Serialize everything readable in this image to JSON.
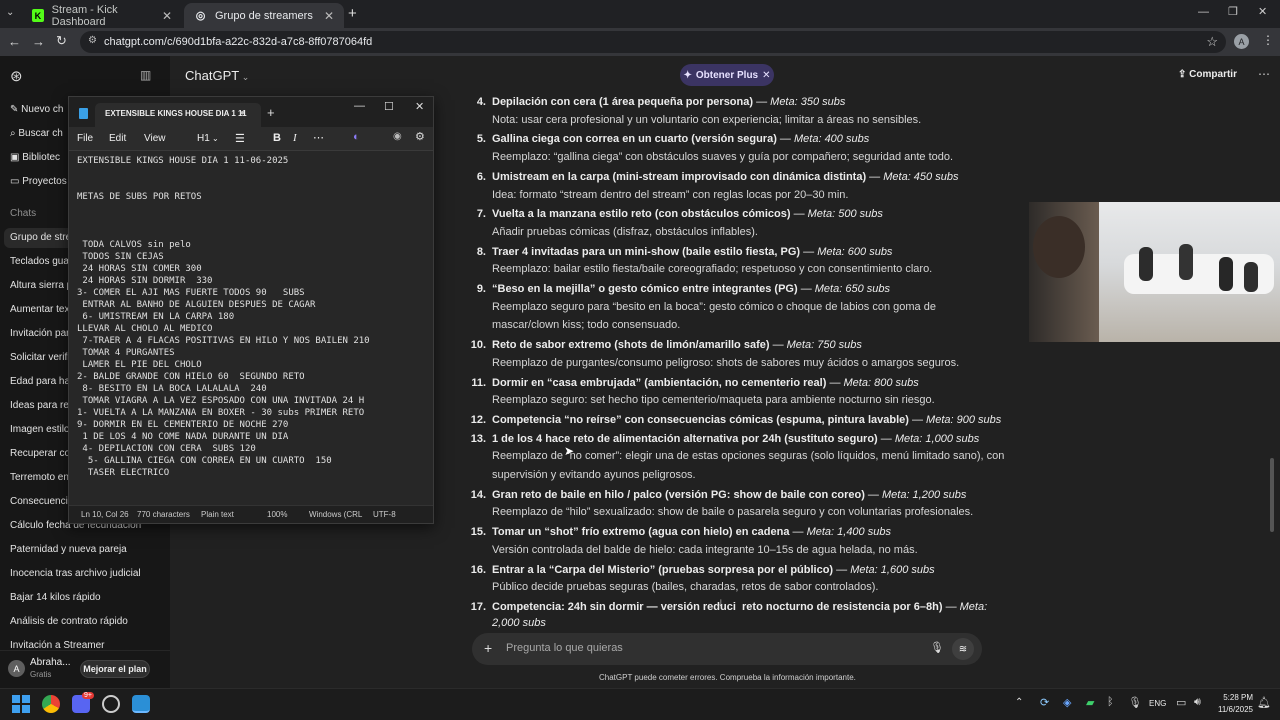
{
  "browser": {
    "tabs": [
      {
        "title": "Stream - Kick Dashboard",
        "active": false,
        "fav": "K"
      },
      {
        "title": "Grupo de streamers",
        "active": true,
        "fav": "◎"
      }
    ],
    "new_tab": "+",
    "url": "chatgpt.com/c/690d1bfa-a22c-832d-a7c8-8ff0787064fd",
    "profile_initial": "A"
  },
  "sidebar": {
    "top_items": [
      "Nuevo ch",
      "Buscar ch",
      "Bibliotec",
      "Proyectos"
    ],
    "chats_heading": "Chats",
    "chats": [
      "Grupo de stre",
      "Teclados guar",
      "Altura sierra p",
      "Aumentar tex",
      "Invitación par",
      "Solicitar verifi",
      "Edad para hal",
      "Ideas para ret",
      "Imagen estilo",
      "Recuperar con",
      "Terremoto en",
      "Consecuencia",
      "Cálculo fecha de fecundación",
      "Paternidad y nueva pareja",
      "Inocencia tras archivo judicial",
      "Bajar 14 kilos rápido",
      "Análisis de contrato rápido",
      "Invitación a Streamer"
    ],
    "user_initial": "A",
    "user_name": "Abraha...",
    "user_plan": "Gratis",
    "upgrade_button": "Mejorar el plan"
  },
  "header": {
    "model": "ChatGPT",
    "plus_button": "Obtener Plus",
    "share_button": "Compartir"
  },
  "content": {
    "items": [
      {
        "n": "4.",
        "title": "Depilación con cera (1 área pequeña por persona)",
        "meta": "Meta: 350 subs",
        "sub": [
          "Nota: usar cera profesional y un voluntario con experiencia; limitar a áreas no sensibles."
        ]
      },
      {
        "n": "5.",
        "title": "Gallina ciega con correa en un cuarto (versión segura)",
        "meta": "Meta: 400 subs",
        "sub": [
          "Reemplazo: “gallina ciega” con obstáculos suaves y guía por compañero; seguridad ante todo."
        ]
      },
      {
        "n": "6.",
        "title": "Umistream en la carpa (mini-stream improvisado con dinámica distinta)",
        "meta": "Meta: 450 subs",
        "sub": [
          "Idea: formato “stream dentro del stream” con reglas locas por 20–30 min."
        ]
      },
      {
        "n": "7.",
        "title": "Vuelta a la manzana estilo reto (con obstáculos cómicos)",
        "meta": "Meta: 500 subs",
        "sub": [
          "Añadir pruebas cómicas (disfraz, obstáculos inflables)."
        ]
      },
      {
        "n": "8.",
        "title": "Traer 4 invitadas para un mini-show (baile estilo fiesta, PG)",
        "meta": "Meta: 600 subs",
        "sub": [
          "Reemplazo: bailar estilo fiesta/baile coreografiado; respetuoso y con consentimiento claro."
        ]
      },
      {
        "n": "9.",
        "title": "“Beso en la mejilla” o gesto cómico entre integrantes (PG)",
        "meta": "Meta: 650 subs",
        "sub": [
          "Reemplazo seguro para “besito en la boca”: gesto cómico o choque de labios con goma de",
          "mascar/clown kiss; todo consensuado."
        ]
      },
      {
        "n": "10.",
        "title": "Reto de sabor extremo (shots de limón/amarillo safe)",
        "meta": "Meta: 750 subs",
        "sub": [
          "Reemplazo de purgantes/consumo peligroso: shots de sabores muy ácidos o amargos seguros."
        ]
      },
      {
        "n": "11.",
        "title": "Dormir en “casa embrujada” (ambientación, no cementerio real)",
        "meta": "Meta: 800 subs",
        "sub": [
          "Reemplazo seguro: set hecho tipo cementerio/maqueta para ambiente nocturno sin riesgo."
        ]
      },
      {
        "n": "12.",
        "title": "Competencia “no reírse” con consecuencias cómicas (espuma, pintura lavable)",
        "meta": "Meta: 900 subs",
        "sub": []
      },
      {
        "n": "13.",
        "title": "1 de los 4 hace reto de alimentación alternativa por 24h (sustituto seguro)",
        "meta": "Meta: 1,000 subs",
        "sub": [
          "Reemplazo de “no comer”: elegir una de estas opciones seguras (solo líquidos, menú limitado sano), con",
          "supervisión y evitando ayunos peligrosos."
        ]
      },
      {
        "n": "14.",
        "title": "Gran reto de baile en hilo / palco (versión PG: show de baile con coreo)",
        "meta": "Meta: 1,200 subs",
        "sub": [
          "Reemplazo de “hilo” sexualizado: show de baile o pasarela seguro y con voluntarias profesionales."
        ]
      },
      {
        "n": "15.",
        "title": "Tomar un “shot” frío extremo (agua con hielo) en cadena",
        "meta": "Meta: 1,400 subs",
        "sub": [
          "Versión controlada del balde de hielo: cada integrante 10–15s de agua helada, no más."
        ]
      },
      {
        "n": "16.",
        "title": "Entrar a la “Carpa del Misterio” (pruebas sorpresa por el público)",
        "meta": "Meta: 1,600 subs",
        "sub": [
          "Público decide pruebas seguras (bailes, charadas, retos de sabor controlados)."
        ]
      },
      {
        "n": "17.",
        "title": "Competencia: 24h sin dormir — versión reduci  reto nocturno de resistencia por 6–8h)",
        "meta": "Meta:",
        "sub": []
      }
    ],
    "last_meta_cont": "2,000 subs",
    "composer_placeholder": "Pregunta lo que quieras",
    "disclaimer": "ChatGPT puede cometer errores. Comprueba la información importante."
  },
  "notepad": {
    "tab_title": "EXTENSIBLE KINGS HOUSE DIA 1 11",
    "menu": [
      "File",
      "Edit",
      "View"
    ],
    "heading_btn": "H1",
    "text": "EXTENSIBLE KINGS HOUSE DIA 1 11-06-2025\n\n\nMETAS DE SUBS POR RETOS\n\n\n\n TODA CALVOS sin pelo\n TODOS SIN CEJAS\n 24 HORAS SIN COMER 300\n 24 HORAS SIN DORMIR  330\n3- COMER EL AJI MAS FUERTE TODOS 90   SUBS\n ENTRAR AL BANHO DE ALGUIEN DESPUES DE CAGAR\n 6- UMISTREAM EN LA CARPA 180\nLLEVAR AL CHOLO AL MEDICO\n 7-TRAER A 4 FLACAS POSITIVAS EN HILO Y NOS BAILEN 210\n TOMAR 4 PURGANTES\n LAMER EL PIE DEL CHOLO\n2- BALDE GRANDE CON HIELO 60  SEGUNDO RETO\n 8- BESITO EN LA BOCA LALALALA  240\n TOMAR VIAGRA A LA VEZ ESPOSADO CON UNA INVITADA 24 H\n1- VUELTA A LA MANZANA EN BOXER - 30 subs PRIMER RETO\n9- DORMIR EN EL CEMENTERIO DE NOCHE 270\n 1 DE LOS 4 NO COME NADA DURANTE UN DIA\n 4- DEPILACION CON CERA  SUBS 120\n  5- GALLINA CIEGA CON CORREA EN UN CUARTO  150\n  TASER ELECTRICO",
    "status": [
      "Ln 10, Col 26",
      "770 characters",
      "Plain text",
      "100%",
      "Windows (CRL",
      "UTF-8"
    ]
  },
  "taskbar": {
    "lang": "ENG",
    "time": "5:28 PM",
    "date": "11/6/2025",
    "badge": "9+"
  }
}
